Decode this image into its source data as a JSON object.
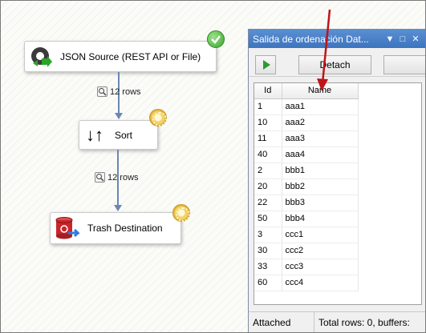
{
  "flow": {
    "json_source": {
      "label": "JSON Source (REST API or File)",
      "status": "success"
    },
    "sort": {
      "label": "Sort",
      "status": "running"
    },
    "trash": {
      "label": "Trash Destination",
      "status": "running"
    },
    "path1_rows": "12 rows",
    "path2_rows": "12 rows"
  },
  "viewer": {
    "title": "Salida de ordenación Dat...",
    "detach_label": "Detach",
    "columns": [
      "Id",
      "Name"
    ],
    "rows": [
      [
        "1",
        "aaa1"
      ],
      [
        "10",
        "aaa2"
      ],
      [
        "11",
        "aaa3"
      ],
      [
        "40",
        "aaa4"
      ],
      [
        "2",
        "bbb1"
      ],
      [
        "20",
        "bbb2"
      ],
      [
        "22",
        "bbb3"
      ],
      [
        "50",
        "bbb4"
      ],
      [
        "3",
        "ccc1"
      ],
      [
        "30",
        "ccc2"
      ],
      [
        "33",
        "ccc3"
      ],
      [
        "60",
        "ccc4"
      ]
    ],
    "status_attached": "Attached",
    "status_totals": "Total rows: 0, buffers:"
  },
  "colors": {
    "titlebar": "#4a83cb",
    "connector": "#6a88b4",
    "annotation": "#c0141a",
    "ok": "#3ea52c"
  }
}
